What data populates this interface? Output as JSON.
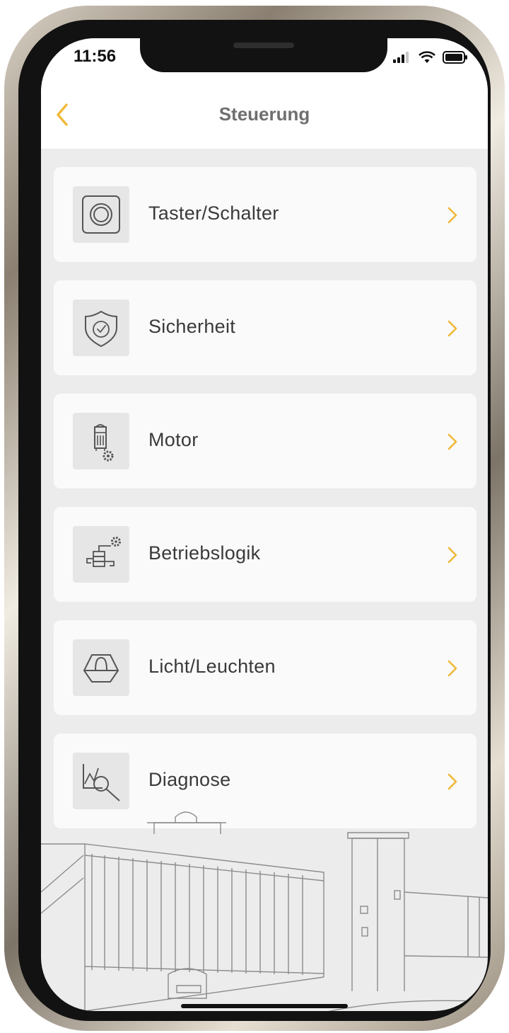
{
  "status_bar": {
    "time": "11:56"
  },
  "nav": {
    "title": "Steuerung"
  },
  "accent_color": "#f0b93a",
  "menu": {
    "items": [
      {
        "label": "Taster/Schalter",
        "icon": "push-button-icon"
      },
      {
        "label": "Sicherheit",
        "icon": "shield-check-icon"
      },
      {
        "label": "Motor",
        "icon": "motor-gear-icon"
      },
      {
        "label": "Betriebslogik",
        "icon": "logic-flow-icon"
      },
      {
        "label": "Licht/Leuchten",
        "icon": "warning-light-icon"
      },
      {
        "label": "Diagnose",
        "icon": "diagnosis-magnifier-icon"
      }
    ]
  }
}
